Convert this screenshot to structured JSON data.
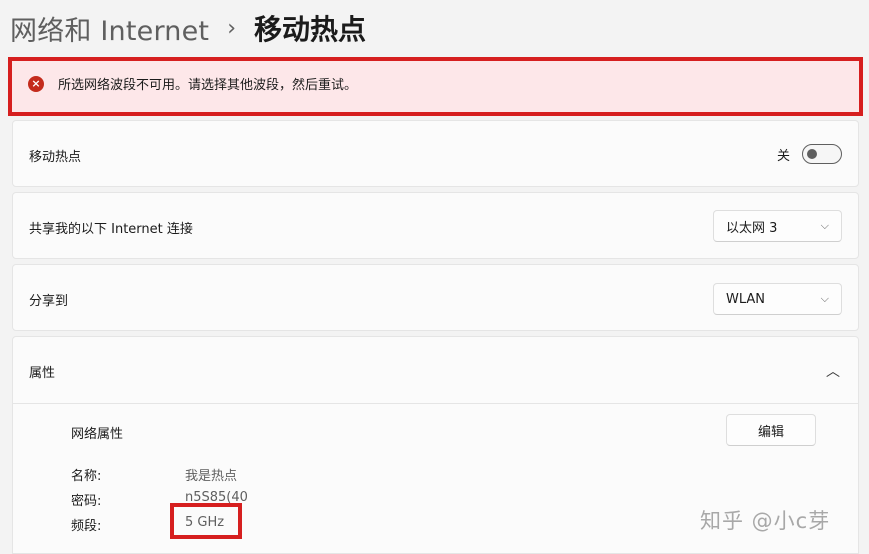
{
  "breadcrumb": {
    "parent": "网络和 Internet",
    "separator": "›",
    "current": "移动热点"
  },
  "error": {
    "icon": "close-circle-icon",
    "icon_glyph": "×",
    "message": "所选网络波段不可用。请选择其他波段，然后重试。",
    "color": "#c42b1c"
  },
  "hotspot": {
    "label": "移动热点",
    "state_label": "关",
    "enabled": false
  },
  "share_connection": {
    "label": "共享我的以下 Internet 连接",
    "selected": "以太网 3"
  },
  "share_to": {
    "label": "分享到",
    "selected": "WLAN"
  },
  "properties": {
    "header_label": "属性",
    "section_title": "网络属性",
    "edit_label": "编辑",
    "name_label": "名称:",
    "name_value": "我是热点",
    "password_label": "密码:",
    "password_value": "n5S85(40",
    "band_label": "频段:",
    "band_value": "5 GHz"
  },
  "watermark": "知乎 @小c芽",
  "colors": {
    "highlight_red": "#d61f1f",
    "error_background": "#fde7e9"
  }
}
